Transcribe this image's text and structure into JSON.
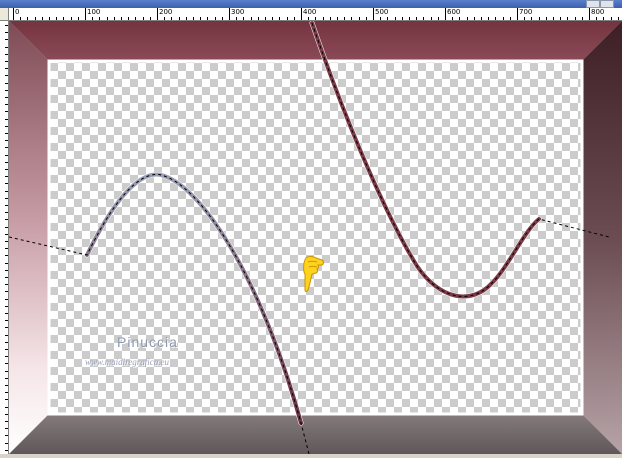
{
  "ruler": {
    "labels": [
      "0",
      "100",
      "200",
      "300",
      "400",
      "500",
      "600",
      "700",
      "800"
    ]
  },
  "watermark": {
    "name": "Pinuccia",
    "url": "www.maidiregrafica.eu"
  },
  "cursor": {
    "icon": "pointing-hand-icon"
  },
  "colors": {
    "frame_top": "#7e3d49",
    "frame_bottom": "#6a6163",
    "stroke": "#7b3a48"
  }
}
